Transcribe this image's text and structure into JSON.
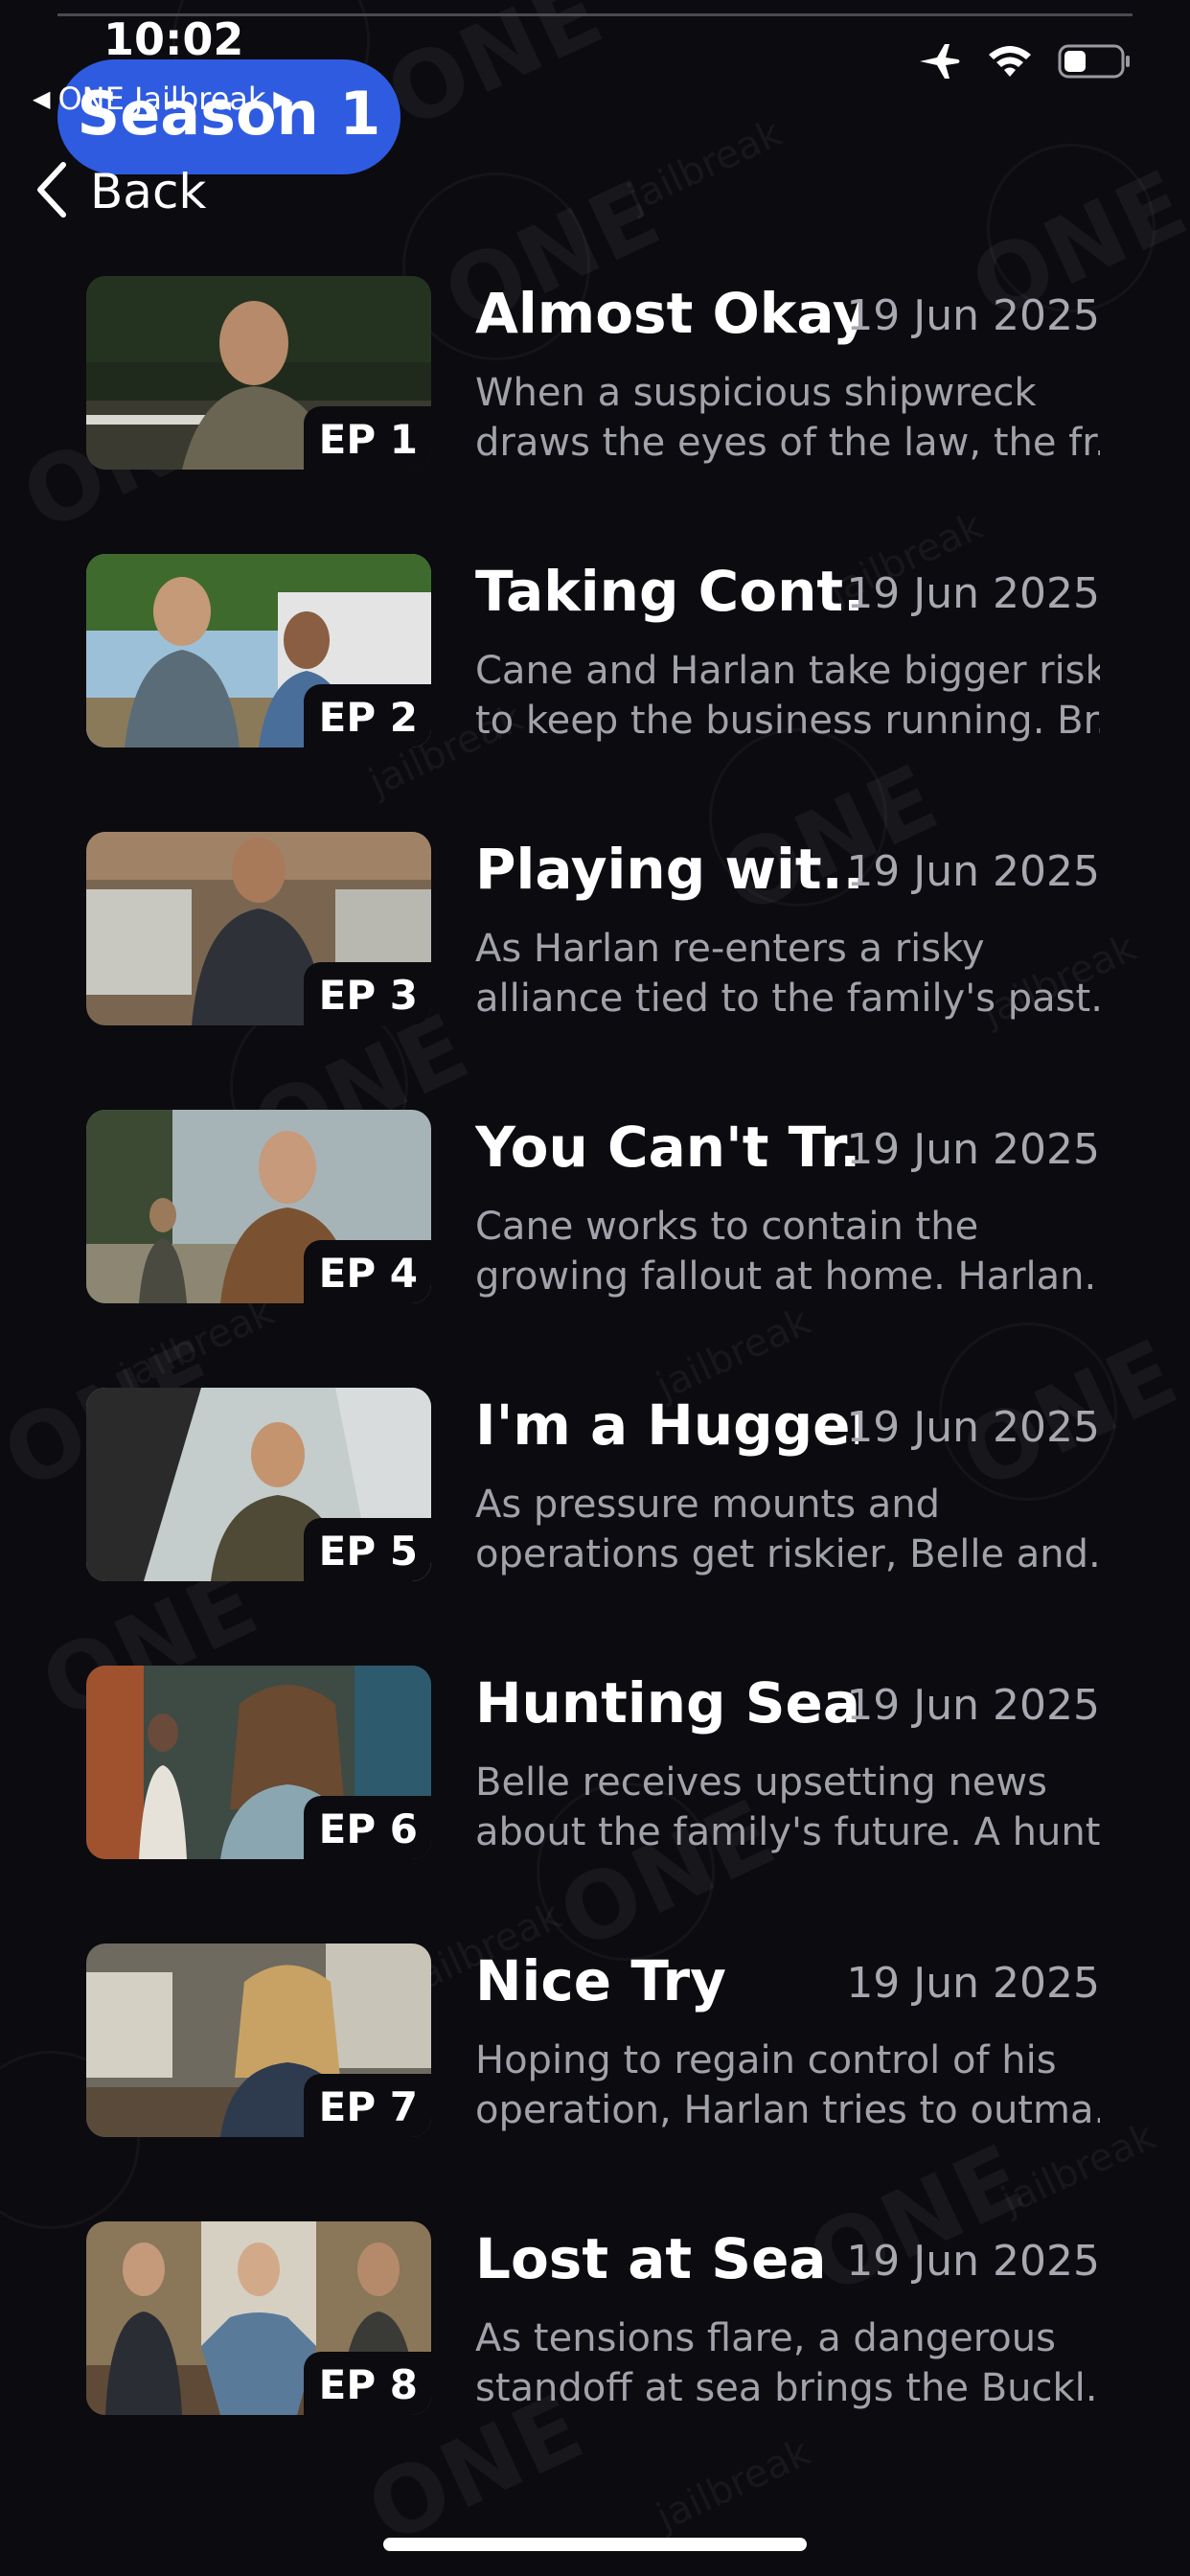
{
  "status": {
    "time": "10:02"
  },
  "header": {
    "season_title": "Season 1",
    "breadcrumb_label": "ONE Jailbreak",
    "back_label": "Back"
  },
  "watermark": {
    "brand": "ONE",
    "sub": "jailbreak"
  },
  "episodes": [
    {
      "badge": "EP 1",
      "title": "Almost Okay",
      "date": "19 Jun 2025",
      "desc_line1": "When a suspicious shipwreck",
      "desc_line2": "draws the eyes of the law, the fr..."
    },
    {
      "badge": "EP 2",
      "title": "Taking Cont...",
      "date": "19 Jun 2025",
      "desc_line1": "Cane and Harlan take bigger risks",
      "desc_line2": "to keep the business running. Br..."
    },
    {
      "badge": "EP 3",
      "title": "Playing wit...",
      "date": "19 Jun 2025",
      "desc_line1": "As Harlan re-enters a risky",
      "desc_line2": "alliance tied to the family's past..."
    },
    {
      "badge": "EP 4",
      "title": "You Can't Tr...",
      "date": "19 Jun 2025",
      "desc_line1": "Cane works to contain the",
      "desc_line2": "growing fallout at home. Harlan..."
    },
    {
      "badge": "EP 5",
      "title": "I'm a Hugger",
      "date": "19 Jun 2025",
      "desc_line1": "As pressure mounts and",
      "desc_line2": "operations get riskier, Belle and..."
    },
    {
      "badge": "EP 6",
      "title": "Hunting Sea...",
      "date": "19 Jun 2025",
      "desc_line1": "Belle receives upsetting news",
      "desc_line2": "about the family's future. A hunt..."
    },
    {
      "badge": "EP 7",
      "title": "Nice Try",
      "date": "19 Jun 2025",
      "desc_line1": "Hoping to regain control of his",
      "desc_line2": "operation, Harlan tries to outma..."
    },
    {
      "badge": "EP 8",
      "title": "Lost at Sea",
      "date": "19 Jun 2025",
      "desc_line1": "As tensions flare, a dangerous",
      "desc_line2": "standoff at sea brings the Buckl..."
    }
  ]
}
